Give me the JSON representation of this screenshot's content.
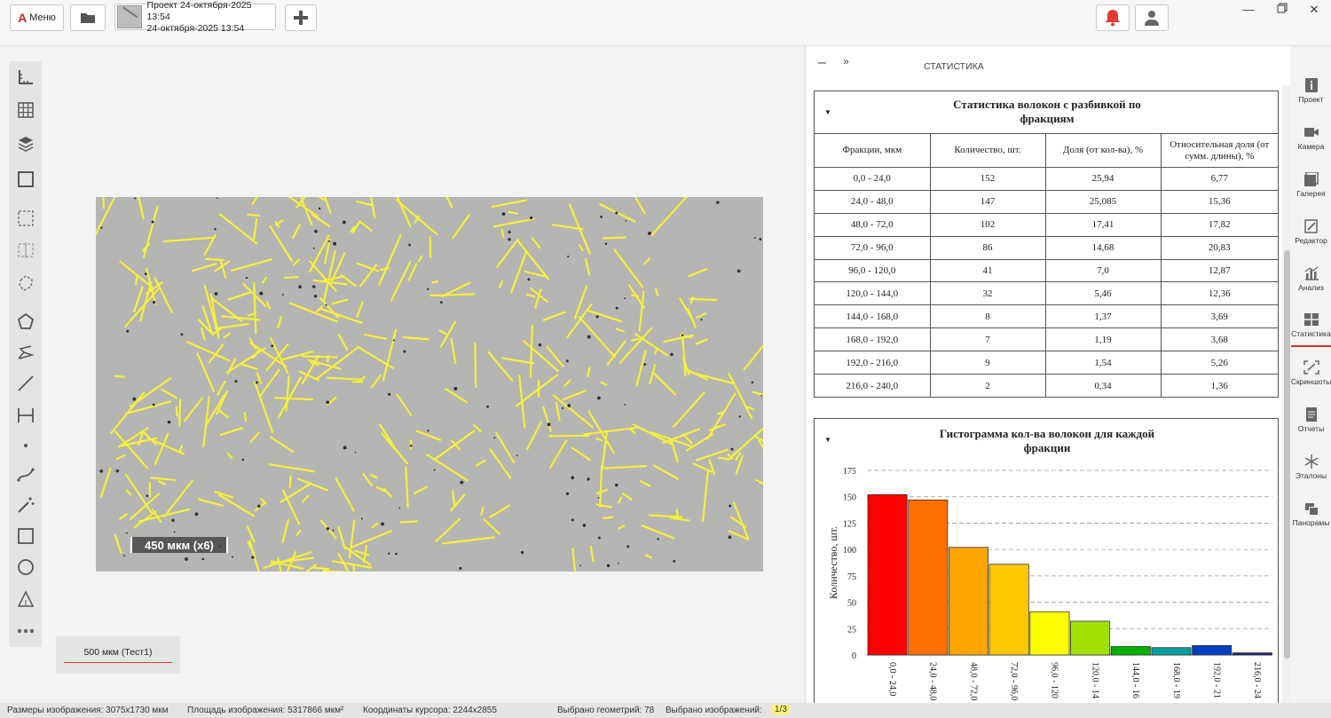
{
  "topbar": {
    "menu_label": "Меню",
    "project_title": "Проект 24-октября-2025 13:54",
    "project_subtitle": "24-октября-2025 13:54",
    "add_icon": "plus-icon",
    "folder_icon": "folder-icon",
    "bell_icon": "bell-icon",
    "user_icon": "user-icon",
    "bell_color": "#e53935"
  },
  "canvas": {
    "scale_label": "450 мкм (x6)",
    "layer_label": "500 мкм (Тест1)",
    "fiber_color": "#f5f03a"
  },
  "panel": {
    "title": "СТАТИСТИКА",
    "minus": "–",
    "chevron": "»"
  },
  "stats": {
    "title_line1": "Статистика волокон с разбивкой по",
    "title_line2": "фракциям",
    "headers": [
      "Фракции, мкм",
      "Количество, шт.",
      "Доля (от кол-ва), %",
      "Относительная доля (от сумм. длины), %"
    ],
    "rows": [
      [
        "0,0 - 24,0",
        "152",
        "25,94",
        "6,77"
      ],
      [
        "24,0 - 48,0",
        "147",
        "25,085",
        "15,36"
      ],
      [
        "48,0 - 72,0",
        "102",
        "17,41",
        "17,82"
      ],
      [
        "72,0 - 96,0",
        "86",
        "14,68",
        "20,83"
      ],
      [
        "96,0 - 120,0",
        "41",
        "7,0",
        "12,87"
      ],
      [
        "120,0 - 144,0",
        "32",
        "5,46",
        "12,36"
      ],
      [
        "144,0 - 168,0",
        "8",
        "1,37",
        "3,69"
      ],
      [
        "168,0 - 192,0",
        "7",
        "1,19",
        "3,68"
      ],
      [
        "192,0 - 216,0",
        "9",
        "1,54",
        "5,26"
      ],
      [
        "216,0 - 240,0",
        "2",
        "0,34",
        "1,36"
      ]
    ]
  },
  "histogram": {
    "title_line1": "Гистограмма кол-ва волокон для каждой",
    "title_line2": "фракции"
  },
  "chart_data": {
    "type": "bar",
    "title": "Гистограмма кол-ва волокон для каждой фракции",
    "ylabel": "Количество, шт.",
    "xlabel": "",
    "ylim": [
      0,
      175
    ],
    "yticks": [
      0,
      25,
      50,
      75,
      100,
      125,
      150,
      175
    ],
    "grid": true,
    "categories": [
      "0,0 - 24,0",
      "24,0 - 48,0",
      "48,0 - 72,0",
      "72,0 - 96,0",
      "96,0 - 120",
      "120,0 - 14",
      "144,0 - 16",
      "168,0 - 19",
      "192,0 - 21",
      "216,0 - 24"
    ],
    "values": [
      152,
      147,
      102,
      86,
      41,
      32,
      8,
      7,
      9,
      2
    ],
    "colors": [
      "#ff0000",
      "#ff7000",
      "#ffa500",
      "#ffc800",
      "#ffff00",
      "#a0e000",
      "#00b000",
      "#00a0a0",
      "#0040c0",
      "#1a1a80"
    ]
  },
  "sidebar": {
    "items": [
      {
        "label": "Проект",
        "icon": "info-icon"
      },
      {
        "label": "Камера",
        "icon": "camera-icon"
      },
      {
        "label": "Галерея",
        "icon": "gallery-icon"
      },
      {
        "label": "Редактор",
        "icon": "editor-icon"
      },
      {
        "label": "Анализ",
        "icon": "analysis-icon"
      },
      {
        "label": "Статистика",
        "icon": "table-icon"
      },
      {
        "label": "Скриншоты",
        "icon": "screenshot-icon"
      },
      {
        "label": "Отчеты",
        "icon": "report-icon"
      },
      {
        "label": "Эталоны",
        "icon": "asterisk-icon"
      },
      {
        "label": "Панорамы",
        "icon": "panorama-icon"
      }
    ]
  },
  "status": {
    "image_size": "Размеры изображения: 3075x1730 мкм",
    "image_area": "Площадь изображения: 5317866 мкм²",
    "cursor": "Координаты курсора: 2244x2855",
    "geometries": "Выбрано геометрий: 78",
    "images_label": "Выбрано изображений:",
    "images_value": "1/3"
  }
}
